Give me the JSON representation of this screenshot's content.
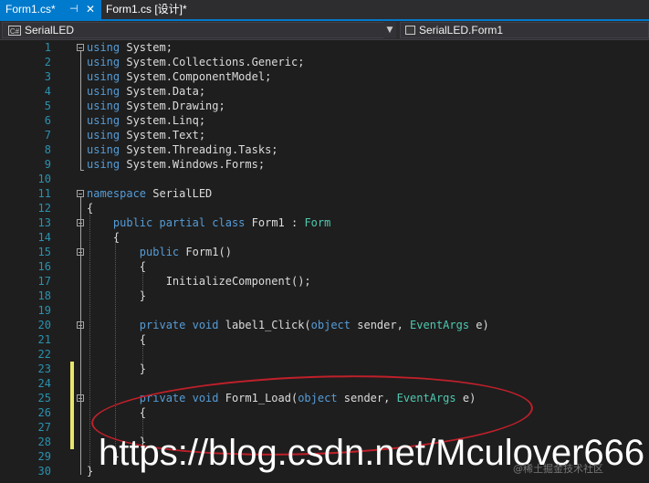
{
  "tabs": [
    {
      "label": "Form1.cs*",
      "pin": "⊣",
      "close": "✕"
    },
    {
      "label": "Form1.cs [设计]*"
    }
  ],
  "navbar": {
    "project_badge": "C#",
    "project": "SerialLED",
    "class_member": "SerialLED.Form1"
  },
  "line_numbers": [
    "1",
    "2",
    "3",
    "4",
    "5",
    "6",
    "7",
    "8",
    "9",
    "10",
    "11",
    "12",
    "13",
    "14",
    "15",
    "16",
    "17",
    "18",
    "19",
    "20",
    "21",
    "22",
    "23",
    "24",
    "25",
    "26",
    "27",
    "28",
    "29",
    "30"
  ],
  "code_lines": [
    [
      "using",
      " System;"
    ],
    [
      "using",
      " System.Collections.Generic;"
    ],
    [
      "using",
      " System.ComponentModel;"
    ],
    [
      "using",
      " System.Data;"
    ],
    [
      "using",
      " System.Drawing;"
    ],
    [
      "using",
      " System.Linq;"
    ],
    [
      "using",
      " System.Text;"
    ],
    [
      "using",
      " System.Threading.Tasks;"
    ],
    [
      "using",
      " System.Windows.Forms;"
    ],
    [
      ""
    ],
    [
      "namespace",
      " SerialLED"
    ],
    [
      "{"
    ],
    [
      "    ",
      "public partial class",
      " ",
      "Form1",
      " : ",
      "Form"
    ],
    [
      "    {"
    ],
    [
      "        ",
      "public",
      " Form1()"
    ],
    [
      "        {"
    ],
    [
      "            InitializeComponent();"
    ],
    [
      "        }"
    ],
    [
      ""
    ],
    [
      "        ",
      "private void",
      " label1_Click(",
      "object",
      " sender, ",
      "EventArgs",
      " e)"
    ],
    [
      "        {"
    ],
    [
      ""
    ],
    [
      "        }"
    ],
    [
      ""
    ],
    [
      "        ",
      "private void",
      " Form1_Load(",
      "object",
      " sender, ",
      "EventArgs",
      " e)"
    ],
    [
      "        {"
    ],
    [
      ""
    ],
    [
      "        }"
    ],
    [
      "    }"
    ],
    [
      "}"
    ]
  ],
  "watermark": {
    "url": "https://blog.csdn.net/Mculover666",
    "credit": "@稀土掘金技术社区"
  },
  "colors": {
    "background": "#1e1e1e",
    "keyword": "#569cd6",
    "type": "#4ec9b0",
    "line_number": "#2b91af",
    "tab_active": "#007acc",
    "annotation": "#c0202a",
    "change_marker": "#e6e66b"
  }
}
